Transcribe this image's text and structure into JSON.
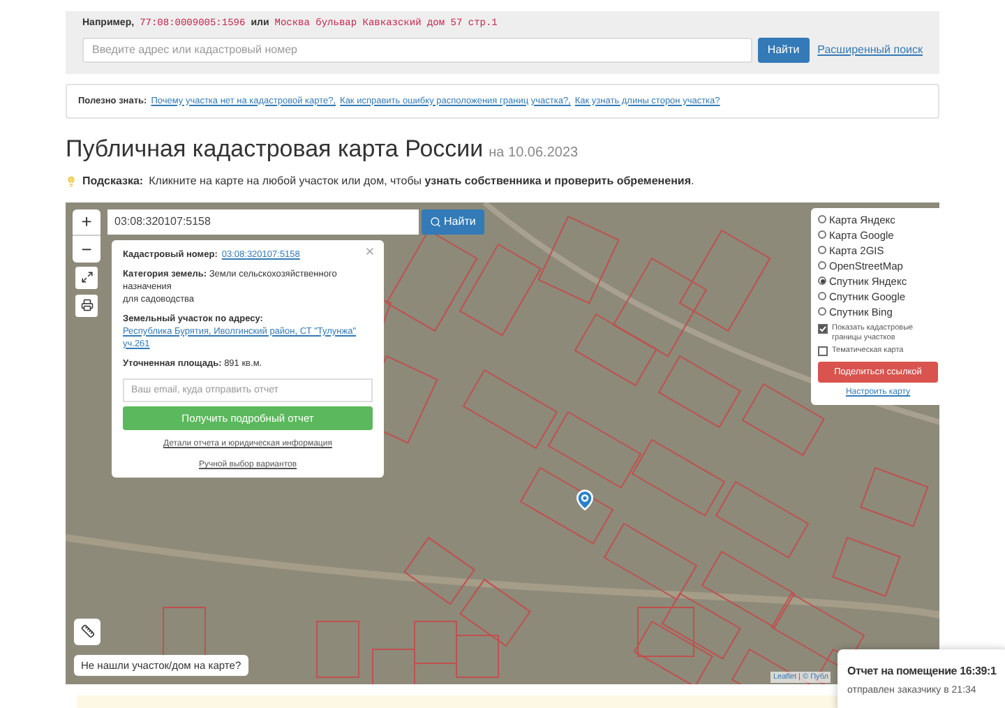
{
  "search": {
    "example_label": "Например,",
    "example_number": "77:08:0009005:1596",
    "example_or": "или",
    "example_address": "Москва бульвар Кавказский дом 57 стр.1",
    "placeholder": "Введите адрес или кадастровый номер",
    "button": "Найти",
    "advanced_link": "Расширенный поиск"
  },
  "info": {
    "label": "Полезно знать:",
    "links": [
      "Почему участка нет на кадастровой карте?,",
      "Как исправить ошибку расположения границ участка?,",
      "Как узнать длины сторон участка?"
    ]
  },
  "title": "Публичная кадастровая карта России",
  "title_date": "на 10.06.2023",
  "hint": {
    "label": "Подсказка:",
    "text": "Кликните на карте на любой участок или дом, чтобы **узнать собственника и проверить обременения**."
  },
  "map": {
    "zoom_in": "+",
    "zoom_out": "−",
    "search_value": "03:08:320107:5158",
    "search_button": "Найти",
    "popup": {
      "rows": [
        {
          "kind": "link",
          "label": "Кадастровый номер:",
          "value": "03:08:320107:5158"
        },
        {
          "kind": "text",
          "label": "Категория земель:",
          "value": "Земли сельскохозяйственного назначения",
          "note": "для садоводства"
        },
        {
          "kind": "link",
          "label": "Земельный участок по адресу:",
          "value": "Республика Бурятия, Иволгинский район, СТ \"Тулунжа\" уч.261"
        },
        {
          "kind": "text",
          "label": "Уточненная площадь:",
          "value": "891 кв.м."
        }
      ],
      "email_placeholder": "Ваш email, куда отправить отчет",
      "button": "Получить подробный отчет",
      "details_link": "Детали отчета и юридическая информация",
      "manual_link": "Ручной выбор вариантов"
    },
    "layers": [
      {
        "label": "Карта Яндекс",
        "selected": false
      },
      {
        "label": "Карта Google",
        "selected": false
      },
      {
        "label": "Карта 2GIS",
        "selected": false
      },
      {
        "label": "OpenStreetMap",
        "selected": false
      },
      {
        "label": "Спутник Яндекс",
        "selected": true
      },
      {
        "label": "Спутник Google",
        "selected": false
      },
      {
        "label": "Спутник Bing",
        "selected": false
      }
    ],
    "options": [
      {
        "label": "Показать кадастровые границы участков",
        "checked": true
      },
      {
        "label": "Тематическая карта",
        "checked": false
      }
    ],
    "share_button": "Поделиться ссылкой",
    "configure_link": "Настроить карту",
    "not_found": "Не нашли участок/дом на карте?",
    "attribution": "Leaflet | © Публ"
  },
  "toast": {
    "title": "Отчет на помещение 16:39:1",
    "subtitle": "отправлен заказчику в 21:34"
  }
}
